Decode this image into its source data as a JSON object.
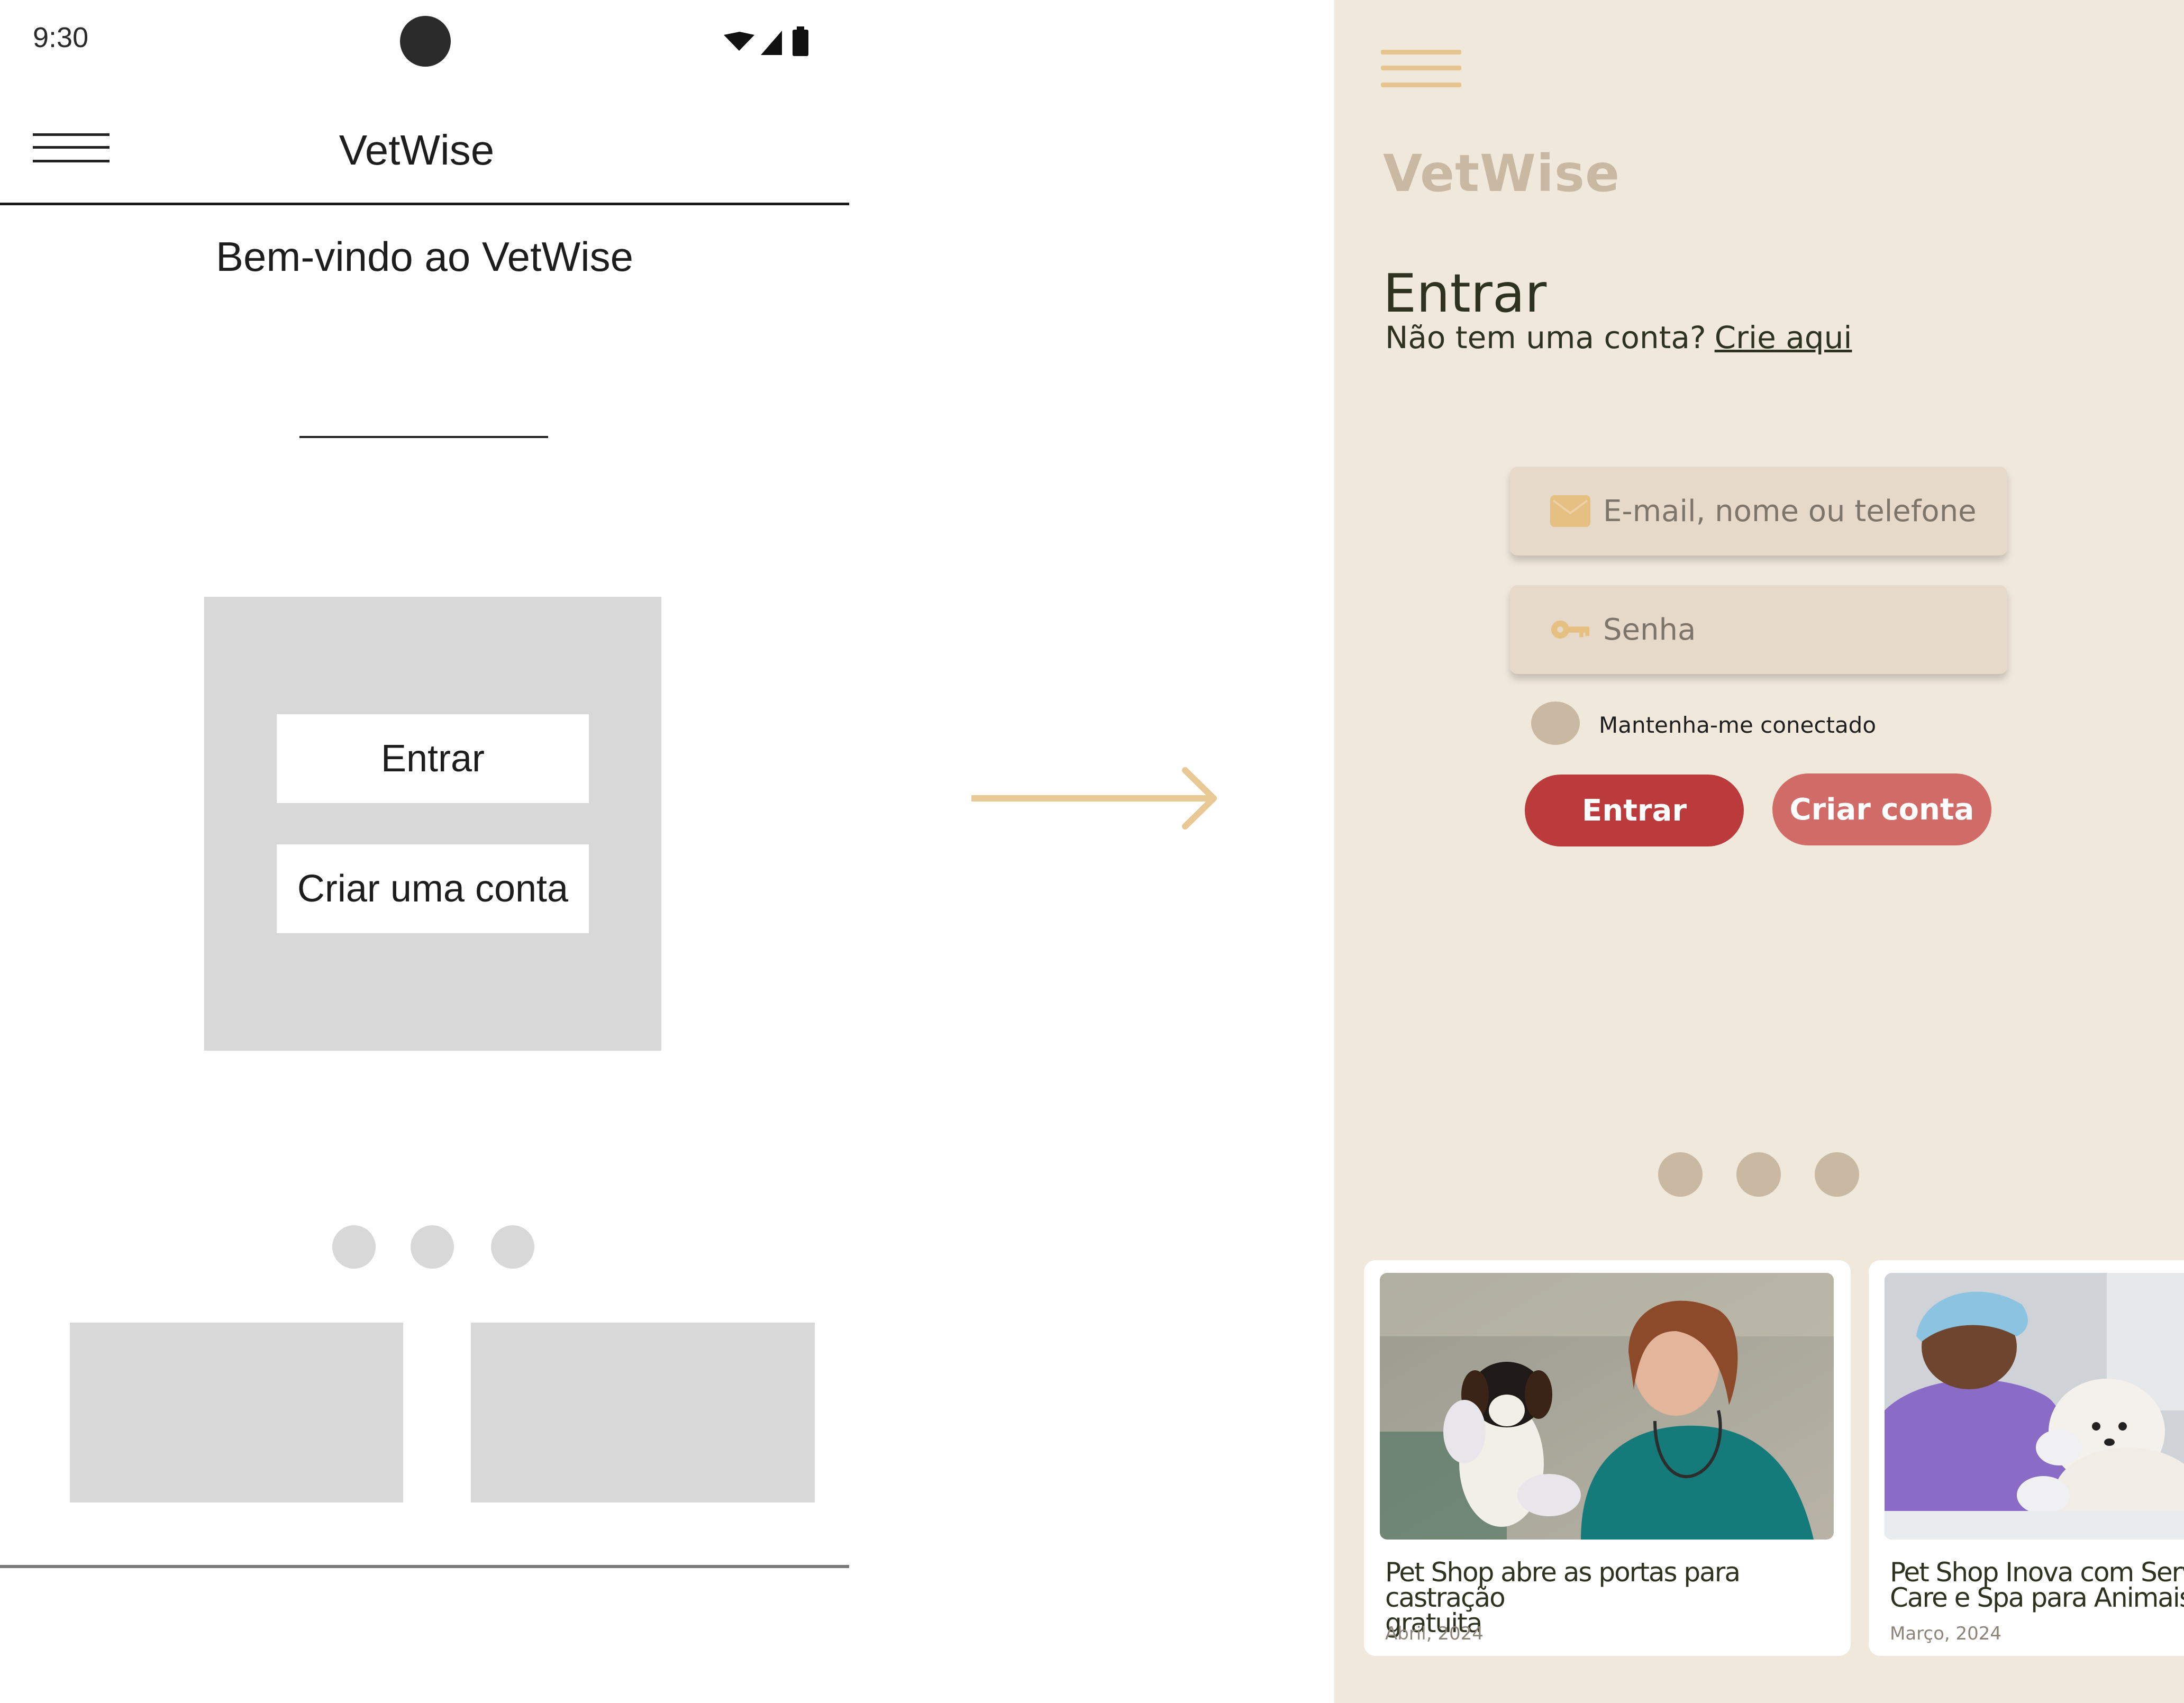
{
  "wireframe": {
    "status_time": "9:30",
    "app_title": "VetWise",
    "welcome": "Bem-vindo ao VetWise",
    "login_button": "Entrar",
    "create_button": "Criar uma conta"
  },
  "mockup": {
    "brand": "VetWise",
    "heading": "Entrar",
    "no_account": "Não tem uma conta?",
    "create_link": "Crie aqui",
    "email_placeholder": "E-mail, nome ou telefone",
    "password_placeholder": "Senha",
    "keep_connected": "Mantenha-me conectado",
    "login_button": "Entrar",
    "create_button": "Criar conta",
    "news": [
      {
        "title_line1": "Pet Shop abre as portas para castração",
        "title_line2": "gratuita",
        "date": "Abril, 2024"
      },
      {
        "title_line1": "Pet Shop Inova com Serviç",
        "title_line2": "Care e Spa para Animais",
        "date": "Março, 2024"
      }
    ]
  },
  "colors": {
    "mock_bg": "#f1e8dc",
    "accent": "#e5c48f",
    "primary_button": "#bb3a3c",
    "secondary_button": "#d16b67",
    "muted": "#c9b9a3",
    "dark_text": "#2e3320"
  }
}
